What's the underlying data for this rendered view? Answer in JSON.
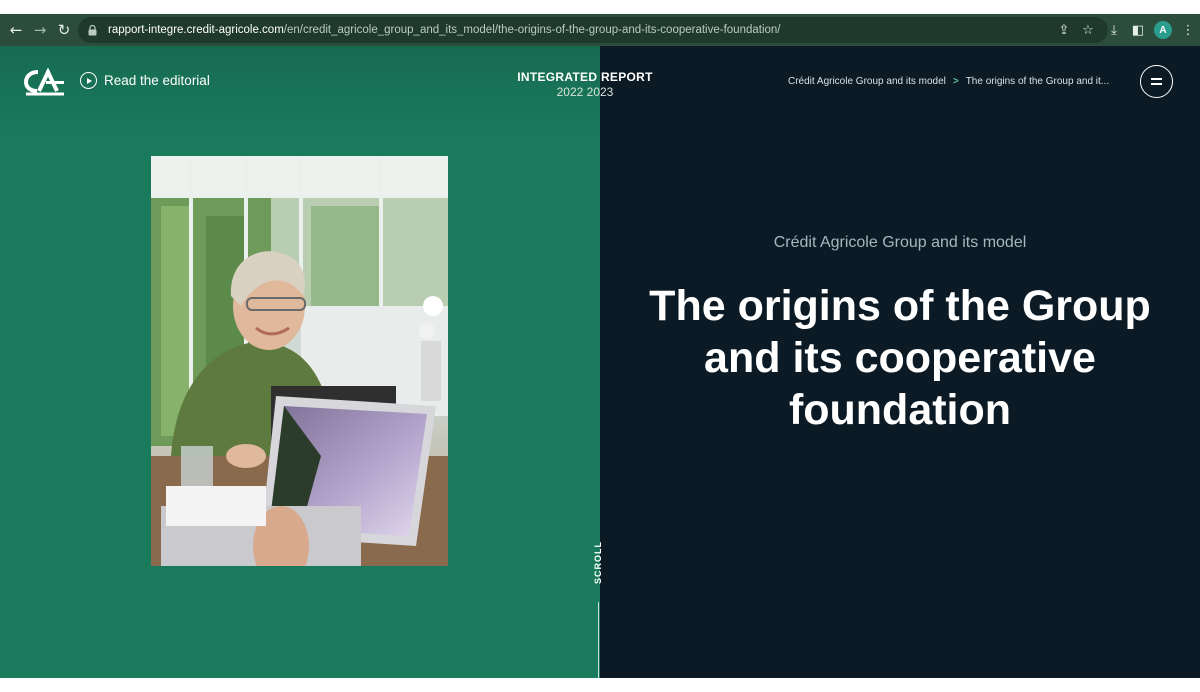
{
  "browser": {
    "back_icon": "←",
    "forward_icon": "→",
    "reload_icon": "↻",
    "url_host": "rapport-integre.credit-agricole.com",
    "url_path": "/en/credit_agricole_group_and_its_model/the-origins-of-the-group-and-its-cooperative-foundation/",
    "share_icon": "⇪",
    "bookmark_icon": "☆",
    "download_icon": "⤓",
    "sidepanel_icon": "◧",
    "profile_initial": "A",
    "more_icon": "⋮"
  },
  "header": {
    "editorial_label": "Read the editorial",
    "report_title": "INTEGRATED REPORT",
    "report_years": "2022 2023",
    "breadcrumb": [
      "Crédit Agricole Group and its model",
      "The origins of the Group and it..."
    ],
    "breadcrumb_separator": ">"
  },
  "hero": {
    "section": "Crédit Agricole Group and its model",
    "title": "The origins of the Group and its cooperative foundation"
  },
  "scroll_label": "SCROLL",
  "colors": {
    "left_panel": "#1a7a5c",
    "right_panel": "#0b1a24",
    "chrome": "#2c4d3c",
    "accent": "#5fc5a0"
  }
}
